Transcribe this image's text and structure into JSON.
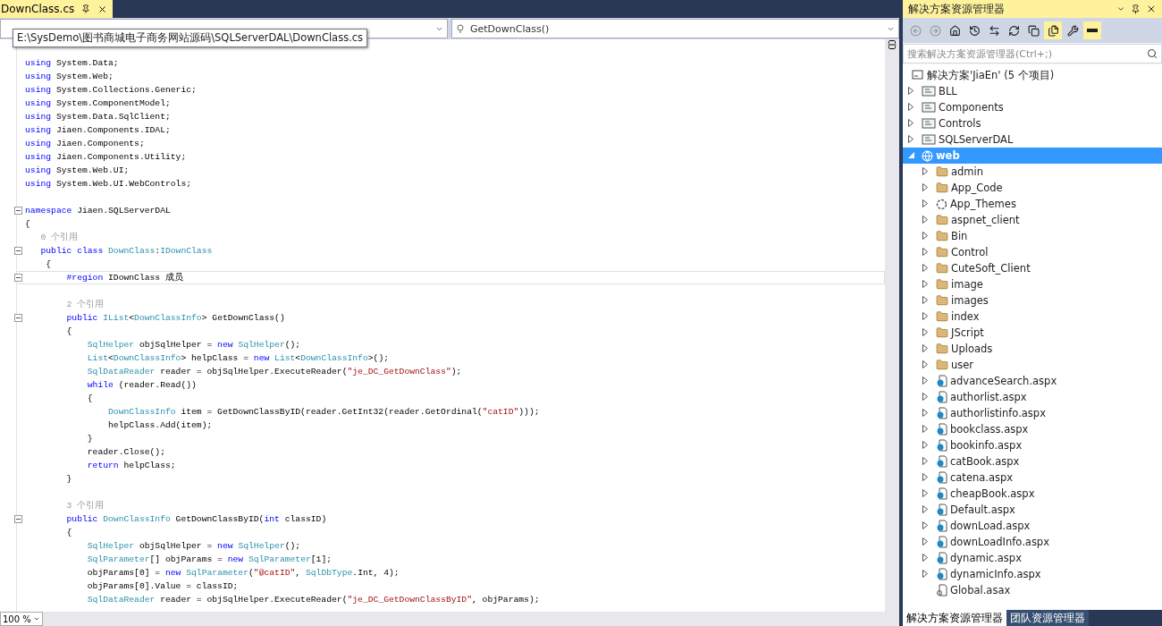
{
  "editor": {
    "tab": {
      "title": "DownClass.cs",
      "selected": true
    },
    "member_dropdown": "GetDownClass()",
    "tooltip": "E:\\SysDemo\\图书商城电子商务网站源码\\SQLServerDAL\\DownClass.cs",
    "lines": [
      {
        "kind": "blank"
      },
      {
        "kind": "code",
        "tokens": [
          {
            "kind": "kw",
            "text": "using "
          },
          {
            "kind": "p",
            "text": "System.Data;"
          }
        ]
      },
      {
        "kind": "code",
        "tokens": [
          {
            "kind": "kw",
            "text": "using "
          },
          {
            "kind": "p",
            "text": "System.Web;"
          }
        ]
      },
      {
        "kind": "code",
        "tokens": [
          {
            "kind": "kw",
            "text": "using "
          },
          {
            "kind": "p",
            "text": "System.Collections.Generic;"
          }
        ]
      },
      {
        "kind": "code",
        "tokens": [
          {
            "kind": "kw",
            "text": "using "
          },
          {
            "kind": "p",
            "text": "System.ComponentModel;"
          }
        ]
      },
      {
        "kind": "code",
        "tokens": [
          {
            "kind": "kw",
            "text": "using "
          },
          {
            "kind": "p",
            "text": "System.Data.SqlClient;"
          }
        ]
      },
      {
        "kind": "code",
        "tokens": [
          {
            "kind": "kw",
            "text": "using "
          },
          {
            "kind": "p",
            "text": "Jiaen.Components.IDAL;"
          }
        ]
      },
      {
        "kind": "code",
        "tokens": [
          {
            "kind": "kw",
            "text": "using "
          },
          {
            "kind": "p",
            "text": "Jiaen.Components;"
          }
        ]
      },
      {
        "kind": "code",
        "tokens": [
          {
            "kind": "kw",
            "text": "using "
          },
          {
            "kind": "p",
            "text": "Jiaen.Components.Utility;"
          }
        ]
      },
      {
        "kind": "code",
        "tokens": [
          {
            "kind": "kw",
            "text": "using "
          },
          {
            "kind": "p",
            "text": "System.Web.UI;"
          }
        ]
      },
      {
        "kind": "code",
        "tokens": [
          {
            "kind": "kw",
            "text": "using "
          },
          {
            "kind": "p",
            "text": "System.Web.UI.WebControls;"
          }
        ]
      },
      {
        "kind": "blank"
      },
      {
        "kind": "code",
        "fold": true,
        "tokens": [
          {
            "kind": "kw",
            "text": "namespace "
          },
          {
            "kind": "p",
            "text": "Jiaen.SQLServerDAL"
          }
        ]
      },
      {
        "kind": "code",
        "tokens": [
          {
            "kind": "p",
            "text": "{"
          }
        ]
      },
      {
        "kind": "code",
        "tokens": [
          {
            "kind": "hint",
            "text": "   0 个引用"
          }
        ]
      },
      {
        "kind": "code",
        "fold": true,
        "tokens": [
          {
            "kind": "kw",
            "text": "   public class "
          },
          {
            "kind": "ty",
            "text": "DownClass"
          },
          {
            "kind": "p",
            "text": ":"
          },
          {
            "kind": "ty",
            "text": "IDownClass"
          }
        ]
      },
      {
        "kind": "code",
        "tokens": [
          {
            "kind": "p",
            "text": "    {"
          }
        ]
      },
      {
        "kind": "code",
        "fold": true,
        "current": true,
        "tokens": [
          {
            "kind": "kw",
            "text": "        #region "
          },
          {
            "kind": "p",
            "text": "IDownClass 成员"
          }
        ]
      },
      {
        "kind": "blank"
      },
      {
        "kind": "code",
        "tokens": [
          {
            "kind": "hint",
            "text": "        2 个引用"
          }
        ]
      },
      {
        "kind": "code",
        "fold": true,
        "tokens": [
          {
            "kind": "kw",
            "text": "        public "
          },
          {
            "kind": "ty",
            "text": "IList"
          },
          {
            "kind": "p",
            "text": "<"
          },
          {
            "kind": "ty",
            "text": "DownClassInfo"
          },
          {
            "kind": "p",
            "text": "> GetDownClass()"
          }
        ]
      },
      {
        "kind": "code",
        "tokens": [
          {
            "kind": "p",
            "text": "        {"
          }
        ]
      },
      {
        "kind": "code",
        "tokens": [
          {
            "kind": "ty",
            "text": "            SqlHelper"
          },
          {
            "kind": "p",
            "text": " objSqlHelper = "
          },
          {
            "kind": "kw",
            "text": "new "
          },
          {
            "kind": "ty",
            "text": "SqlHelper"
          },
          {
            "kind": "p",
            "text": "();"
          }
        ]
      },
      {
        "kind": "code",
        "tokens": [
          {
            "kind": "ty",
            "text": "            List"
          },
          {
            "kind": "p",
            "text": "<"
          },
          {
            "kind": "ty",
            "text": "DownClassInfo"
          },
          {
            "kind": "p",
            "text": "> helpClass = "
          },
          {
            "kind": "kw",
            "text": "new "
          },
          {
            "kind": "ty",
            "text": "List"
          },
          {
            "kind": "p",
            "text": "<"
          },
          {
            "kind": "ty",
            "text": "DownClassInfo"
          },
          {
            "kind": "p",
            "text": ">();"
          }
        ]
      },
      {
        "kind": "code",
        "tokens": [
          {
            "kind": "ty",
            "text": "            SqlDataReader"
          },
          {
            "kind": "p",
            "text": " reader = objSqlHelper.ExecuteReader("
          },
          {
            "kind": "s",
            "text": "\"je_DC_GetDownClass\""
          },
          {
            "kind": "p",
            "text": ");"
          }
        ]
      },
      {
        "kind": "code",
        "tokens": [
          {
            "kind": "kw",
            "text": "            while"
          },
          {
            "kind": "p",
            "text": " (reader.Read())"
          }
        ]
      },
      {
        "kind": "code",
        "tokens": [
          {
            "kind": "p",
            "text": "            {"
          }
        ]
      },
      {
        "kind": "code",
        "tokens": [
          {
            "kind": "ty",
            "text": "                DownClassInfo"
          },
          {
            "kind": "p",
            "text": " item = GetDownClassByID(reader.GetInt32(reader.GetOrdinal("
          },
          {
            "kind": "s",
            "text": "\"catID\""
          },
          {
            "kind": "p",
            "text": ")));"
          }
        ]
      },
      {
        "kind": "code",
        "tokens": [
          {
            "kind": "p",
            "text": "                helpClass.Add(item);"
          }
        ]
      },
      {
        "kind": "code",
        "tokens": [
          {
            "kind": "p",
            "text": "            }"
          }
        ]
      },
      {
        "kind": "code",
        "tokens": [
          {
            "kind": "p",
            "text": "            reader.Close();"
          }
        ]
      },
      {
        "kind": "code",
        "tokens": [
          {
            "kind": "kw",
            "text": "            return"
          },
          {
            "kind": "p",
            "text": " helpClass;"
          }
        ]
      },
      {
        "kind": "code",
        "tokens": [
          {
            "kind": "p",
            "text": "        }"
          }
        ]
      },
      {
        "kind": "blank"
      },
      {
        "kind": "code",
        "tokens": [
          {
            "kind": "hint",
            "text": "        3 个引用"
          }
        ]
      },
      {
        "kind": "code",
        "fold": true,
        "tokens": [
          {
            "kind": "kw",
            "text": "        public "
          },
          {
            "kind": "ty",
            "text": "DownClassInfo"
          },
          {
            "kind": "p",
            "text": " GetDownClassByID("
          },
          {
            "kind": "kw",
            "text": "int"
          },
          {
            "kind": "p",
            "text": " classID)"
          }
        ]
      },
      {
        "kind": "code",
        "tokens": [
          {
            "kind": "p",
            "text": "        {"
          }
        ]
      },
      {
        "kind": "code",
        "tokens": [
          {
            "kind": "ty",
            "text": "            SqlHelper"
          },
          {
            "kind": "p",
            "text": " objSqlHelper = "
          },
          {
            "kind": "kw",
            "text": "new "
          },
          {
            "kind": "ty",
            "text": "SqlHelper"
          },
          {
            "kind": "p",
            "text": "();"
          }
        ]
      },
      {
        "kind": "code",
        "tokens": [
          {
            "kind": "ty",
            "text": "            SqlParameter"
          },
          {
            "kind": "p",
            "text": "[] objParams = "
          },
          {
            "kind": "kw",
            "text": "new "
          },
          {
            "kind": "ty",
            "text": "SqlParameter"
          },
          {
            "kind": "p",
            "text": "[1];"
          }
        ]
      },
      {
        "kind": "code",
        "tokens": [
          {
            "kind": "p",
            "text": "            objParams[0] = "
          },
          {
            "kind": "kw",
            "text": "new "
          },
          {
            "kind": "ty",
            "text": "SqlParameter"
          },
          {
            "kind": "p",
            "text": "("
          },
          {
            "kind": "s",
            "text": "\"@catID\""
          },
          {
            "kind": "p",
            "text": ", "
          },
          {
            "kind": "ty",
            "text": "SqlDbType"
          },
          {
            "kind": "p",
            "text": ".Int, 4);"
          }
        ]
      },
      {
        "kind": "code",
        "tokens": [
          {
            "kind": "p",
            "text": "            objParams[0].Value = classID;"
          }
        ]
      },
      {
        "kind": "code",
        "tokens": [
          {
            "kind": "ty",
            "text": "            SqlDataReader"
          },
          {
            "kind": "p",
            "text": " reader = objSqlHelper.ExecuteReader("
          },
          {
            "kind": "s",
            "text": "\"je_DC_GetDownClassByID\""
          },
          {
            "kind": "p",
            "text": ", objParams);"
          }
        ]
      }
    ],
    "zoom": "100 %"
  },
  "explorer": {
    "title": "解决方案资源管理器",
    "toolbar": [
      {
        "kind": "back",
        "on": false
      },
      {
        "kind": "forward",
        "on": false
      },
      {
        "kind": "home",
        "on": false
      },
      {
        "kind": "history",
        "on": false
      },
      {
        "kind": "sync",
        "on": false
      },
      {
        "kind": "refresh",
        "on": false
      },
      {
        "kind": "collapse",
        "on": false
      },
      {
        "kind": "showall",
        "on": true
      },
      {
        "kind": "properties",
        "on": false
      },
      {
        "kind": "preview",
        "on": true
      }
    ],
    "search": {
      "placeholder": "搜索解决方案资源管理器(Ctrl+;)"
    },
    "tree": {
      "label": "解决方案'JiaEn' (5 个项目)",
      "kind": "solution",
      "children": [
        {
          "label": "BLL",
          "kind": "project",
          "expanded": false,
          "selected": false
        },
        {
          "label": "Components",
          "kind": "project",
          "expanded": false,
          "selected": false
        },
        {
          "label": "Controls",
          "kind": "project",
          "expanded": false,
          "selected": false
        },
        {
          "label": "SQLServerDAL",
          "kind": "project",
          "expanded": false,
          "selected": false
        },
        {
          "label": "web",
          "kind": "web",
          "expanded": true,
          "selected": true,
          "children": [
            {
              "label": "admin",
              "kind": "folder",
              "expanded": false,
              "selected": false
            },
            {
              "label": "App_Code",
              "kind": "folder",
              "expanded": false,
              "selected": false
            },
            {
              "label": "App_Themes",
              "kind": "themes",
              "expanded": false,
              "selected": false
            },
            {
              "label": "aspnet_client",
              "kind": "folder",
              "expanded": false,
              "selected": false
            },
            {
              "label": "Bin",
              "kind": "folder",
              "expanded": false,
              "selected": false
            },
            {
              "label": "Control",
              "kind": "folder",
              "expanded": false,
              "selected": false
            },
            {
              "label": "CuteSoft_Client",
              "kind": "folder",
              "expanded": false,
              "selected": false
            },
            {
              "label": "image",
              "kind": "folder",
              "expanded": false,
              "selected": false
            },
            {
              "label": "images",
              "kind": "folder",
              "expanded": false,
              "selected": false
            },
            {
              "label": "index",
              "kind": "folder",
              "expanded": false,
              "selected": false
            },
            {
              "label": "JScript",
              "kind": "folder",
              "expanded": false,
              "selected": false
            },
            {
              "label": "Uploads",
              "kind": "folder",
              "expanded": false,
              "selected": false
            },
            {
              "label": "user",
              "kind": "folder",
              "expanded": false,
              "selected": false
            },
            {
              "label": "advanceSearch.aspx",
              "kind": "page",
              "expanded": false,
              "selected": false
            },
            {
              "label": "authorlist.aspx",
              "kind": "page",
              "expanded": false,
              "selected": false
            },
            {
              "label": "authorlistinfo.aspx",
              "kind": "page",
              "expanded": false,
              "selected": false
            },
            {
              "label": "bookclass.aspx",
              "kind": "page",
              "expanded": false,
              "selected": false
            },
            {
              "label": "bookinfo.aspx",
              "kind": "page",
              "expanded": false,
              "selected": false
            },
            {
              "label": "catBook.aspx",
              "kind": "page",
              "expanded": false,
              "selected": false
            },
            {
              "label": "catena.aspx",
              "kind": "page",
              "expanded": false,
              "selected": false
            },
            {
              "label": "cheapBook.aspx",
              "kind": "page",
              "expanded": false,
              "selected": false
            },
            {
              "label": "Default.aspx",
              "kind": "page",
              "expanded": false,
              "selected": false
            },
            {
              "label": "downLoad.aspx",
              "kind": "page",
              "expanded": false,
              "selected": false
            },
            {
              "label": "downLoadInfo.aspx",
              "kind": "page",
              "expanded": false,
              "selected": false
            },
            {
              "label": "dynamic.aspx",
              "kind": "page",
              "expanded": false,
              "selected": false
            },
            {
              "label": "dynamicInfo.aspx",
              "kind": "page",
              "expanded": false,
              "selected": false
            },
            {
              "label": "Global.asax",
              "kind": "global",
              "selected": false
            }
          ]
        }
      ]
    },
    "bottom_tabs": [
      {
        "label": "解决方案资源管理器",
        "selected": true
      },
      {
        "label": "团队资源管理器",
        "selected": false
      }
    ]
  }
}
